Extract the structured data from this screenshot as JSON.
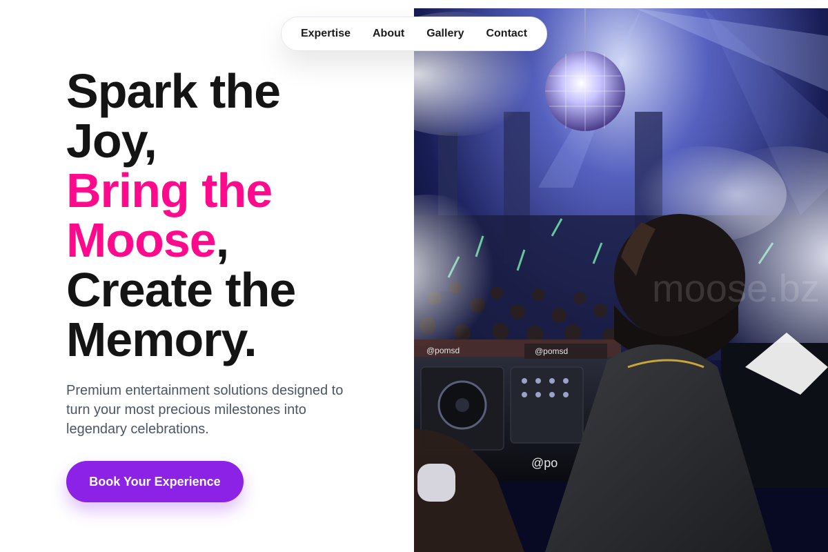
{
  "nav": {
    "items": [
      {
        "label": "Expertise"
      },
      {
        "label": "About"
      },
      {
        "label": "Gallery"
      },
      {
        "label": "Contact"
      }
    ]
  },
  "hero": {
    "headline": {
      "line1": "Spark the",
      "line2": "Joy,",
      "line3": "Bring the",
      "line4_accent": "Moose",
      "line4_tail": ",",
      "line5": "Create the",
      "line6": "Memory."
    },
    "subcopy": "Premium entertainment solutions designed to turn your most precious milestones into legendary celebrations.",
    "cta_label": "Book Your Experience",
    "image_watermark": "moose.bz",
    "dj_booth_tags": [
      "@pomsd",
      "@pomsd",
      "@po",
      "msd"
    ]
  },
  "colors": {
    "accent_pink": "#ff0a8c",
    "cta_purple": "#8b22e6",
    "text_dark": "#141414",
    "text_muted": "#4a5566"
  }
}
